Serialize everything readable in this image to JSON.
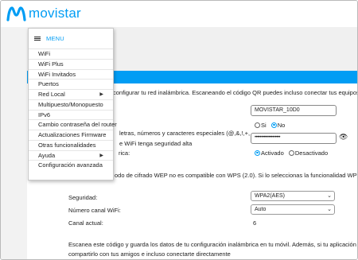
{
  "brand": {
    "name": "movistar",
    "color": "#019df4"
  },
  "menu": {
    "title": "MENU",
    "items": [
      {
        "label": "WiFi",
        "submenu": false
      },
      {
        "label": "WiFi Plus",
        "submenu": false
      },
      {
        "label": "WiFi Invitados",
        "submenu": false
      },
      {
        "label": "Puertos",
        "submenu": false
      },
      {
        "label": "Red Local",
        "submenu": true
      },
      {
        "label": "Multipuesto/Monopuesto",
        "submenu": false
      },
      {
        "label": "IPv6",
        "submenu": false
      },
      {
        "label": "Cambio contraseña del router",
        "submenu": false
      },
      {
        "label": "Actualizaciones Firmware",
        "submenu": false
      },
      {
        "label": "Otras funcionalidades",
        "submenu": false
      },
      {
        "label": "Ayuda",
        "submenu": true
      },
      {
        "label": "Configuración avanzada",
        "submenu": false
      }
    ]
  },
  "content": {
    "intro": "configurar tu red inalámbrica. Escaneando el código QR puedes incluso conectar tus equipos directa",
    "password_hint_1": "letras, números y caracteres especiales (@,&,!,+,",
    "password_hint_2": "e WiFi tenga seguridad alta",
    "row_label_3": "rica:",
    "wep_note": "odo de cifrado WEP no es compatible con WPS (2.0). Si lo seleccionas la funcionalidad WPS quedar",
    "ssid_value": "MOVISTAR_10D0",
    "hide_ssid": {
      "yes": "Si",
      "no": "No",
      "selected": "No"
    },
    "password_value": "••••••••••••••••••••",
    "band_mode": {
      "on": "Activado",
      "off": "Desactivado",
      "selected": "Activado"
    },
    "security_label": "Seguridad:",
    "security_value": "WPA2(AES)",
    "channel_label": "Número canal WiFi:",
    "channel_value": "Auto",
    "current_channel_label": "Canal actual:",
    "current_channel_value": "6",
    "qr_note_1": "Escanea este código y guarda los datos de tu configuración inalámbrica en tu móvil. Además, si tu aplicación de escane",
    "qr_note_2": "compartirlo con tus amigos e incluso conectarte directamente"
  }
}
